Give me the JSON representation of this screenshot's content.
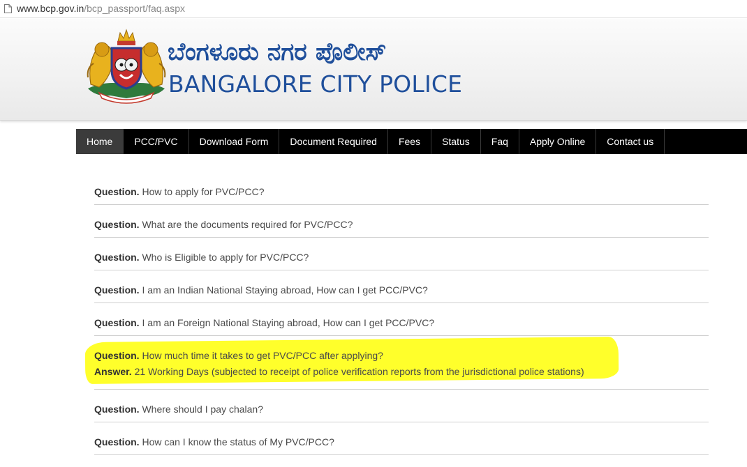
{
  "browser": {
    "url_host": "www.bcp.gov.in",
    "url_path": "/bcp_passport/faq.aspx"
  },
  "header": {
    "title_kannada": "ಬೆಂಗಳೂರು ನಗರ ಪೊಲೀಸ್",
    "title_english": "BANGALORE CITY POLICE",
    "emblem_icon": "karnataka-state-emblem"
  },
  "nav": {
    "items": [
      {
        "label": "Home",
        "active": true
      },
      {
        "label": "PCC/PVC"
      },
      {
        "label": "Download Form"
      },
      {
        "label": "Document Required"
      },
      {
        "label": "Fees"
      },
      {
        "label": "Status"
      },
      {
        "label": "Faq"
      },
      {
        "label": "Apply Online"
      },
      {
        "label": "Contact us"
      }
    ]
  },
  "faq": {
    "question_prefix": "Question.",
    "answer_prefix": "Answer.",
    "items": [
      {
        "q": "How to apply for PVC/PCC?"
      },
      {
        "q": "What are the documents required for PVC/PCC?"
      },
      {
        "q": "Who is Eligible to apply for PVC/PCC?"
      },
      {
        "q": "I am an Indian National Staying abroad, How can I get PCC/PVC?"
      },
      {
        "q": "I am an Foreign National Staying abroad, How can I get PCC/PVC?"
      },
      {
        "q": "How much time it takes to get PVC/PCC after applying?",
        "a": "21 Working Days (subjected to receipt of police verification reports from the jurisdictional police stations)"
      },
      {
        "q": "Where should I pay chalan?"
      },
      {
        "q": "How can I know the status of My PVC/PCC?"
      }
    ]
  },
  "colors": {
    "brand_blue": "#1f4f9b",
    "nav_bg": "#000000",
    "highlight": "#ffff2b"
  }
}
